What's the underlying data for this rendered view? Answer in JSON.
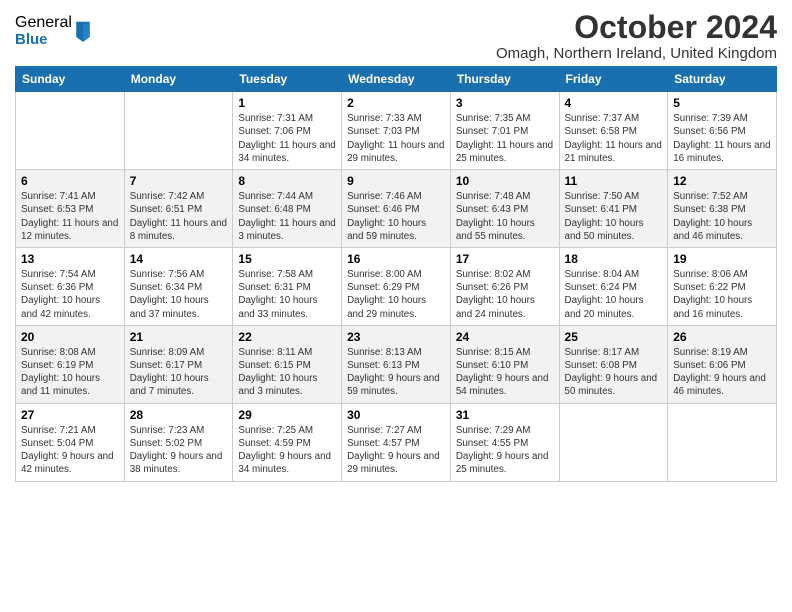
{
  "logo": {
    "general": "General",
    "blue": "Blue"
  },
  "title": "October 2024",
  "subtitle": "Omagh, Northern Ireland, United Kingdom",
  "days_of_week": [
    "Sunday",
    "Monday",
    "Tuesday",
    "Wednesday",
    "Thursday",
    "Friday",
    "Saturday"
  ],
  "weeks": [
    [
      {
        "day": "",
        "detail": ""
      },
      {
        "day": "",
        "detail": ""
      },
      {
        "day": "1",
        "detail": "Sunrise: 7:31 AM\nSunset: 7:06 PM\nDaylight: 11 hours and 34 minutes."
      },
      {
        "day": "2",
        "detail": "Sunrise: 7:33 AM\nSunset: 7:03 PM\nDaylight: 11 hours and 29 minutes."
      },
      {
        "day": "3",
        "detail": "Sunrise: 7:35 AM\nSunset: 7:01 PM\nDaylight: 11 hours and 25 minutes."
      },
      {
        "day": "4",
        "detail": "Sunrise: 7:37 AM\nSunset: 6:58 PM\nDaylight: 11 hours and 21 minutes."
      },
      {
        "day": "5",
        "detail": "Sunrise: 7:39 AM\nSunset: 6:56 PM\nDaylight: 11 hours and 16 minutes."
      }
    ],
    [
      {
        "day": "6",
        "detail": "Sunrise: 7:41 AM\nSunset: 6:53 PM\nDaylight: 11 hours and 12 minutes."
      },
      {
        "day": "7",
        "detail": "Sunrise: 7:42 AM\nSunset: 6:51 PM\nDaylight: 11 hours and 8 minutes."
      },
      {
        "day": "8",
        "detail": "Sunrise: 7:44 AM\nSunset: 6:48 PM\nDaylight: 11 hours and 3 minutes."
      },
      {
        "day": "9",
        "detail": "Sunrise: 7:46 AM\nSunset: 6:46 PM\nDaylight: 10 hours and 59 minutes."
      },
      {
        "day": "10",
        "detail": "Sunrise: 7:48 AM\nSunset: 6:43 PM\nDaylight: 10 hours and 55 minutes."
      },
      {
        "day": "11",
        "detail": "Sunrise: 7:50 AM\nSunset: 6:41 PM\nDaylight: 10 hours and 50 minutes."
      },
      {
        "day": "12",
        "detail": "Sunrise: 7:52 AM\nSunset: 6:38 PM\nDaylight: 10 hours and 46 minutes."
      }
    ],
    [
      {
        "day": "13",
        "detail": "Sunrise: 7:54 AM\nSunset: 6:36 PM\nDaylight: 10 hours and 42 minutes."
      },
      {
        "day": "14",
        "detail": "Sunrise: 7:56 AM\nSunset: 6:34 PM\nDaylight: 10 hours and 37 minutes."
      },
      {
        "day": "15",
        "detail": "Sunrise: 7:58 AM\nSunset: 6:31 PM\nDaylight: 10 hours and 33 minutes."
      },
      {
        "day": "16",
        "detail": "Sunrise: 8:00 AM\nSunset: 6:29 PM\nDaylight: 10 hours and 29 minutes."
      },
      {
        "day": "17",
        "detail": "Sunrise: 8:02 AM\nSunset: 6:26 PM\nDaylight: 10 hours and 24 minutes."
      },
      {
        "day": "18",
        "detail": "Sunrise: 8:04 AM\nSunset: 6:24 PM\nDaylight: 10 hours and 20 minutes."
      },
      {
        "day": "19",
        "detail": "Sunrise: 8:06 AM\nSunset: 6:22 PM\nDaylight: 10 hours and 16 minutes."
      }
    ],
    [
      {
        "day": "20",
        "detail": "Sunrise: 8:08 AM\nSunset: 6:19 PM\nDaylight: 10 hours and 11 minutes."
      },
      {
        "day": "21",
        "detail": "Sunrise: 8:09 AM\nSunset: 6:17 PM\nDaylight: 10 hours and 7 minutes."
      },
      {
        "day": "22",
        "detail": "Sunrise: 8:11 AM\nSunset: 6:15 PM\nDaylight: 10 hours and 3 minutes."
      },
      {
        "day": "23",
        "detail": "Sunrise: 8:13 AM\nSunset: 6:13 PM\nDaylight: 9 hours and 59 minutes."
      },
      {
        "day": "24",
        "detail": "Sunrise: 8:15 AM\nSunset: 6:10 PM\nDaylight: 9 hours and 54 minutes."
      },
      {
        "day": "25",
        "detail": "Sunrise: 8:17 AM\nSunset: 6:08 PM\nDaylight: 9 hours and 50 minutes."
      },
      {
        "day": "26",
        "detail": "Sunrise: 8:19 AM\nSunset: 6:06 PM\nDaylight: 9 hours and 46 minutes."
      }
    ],
    [
      {
        "day": "27",
        "detail": "Sunrise: 7:21 AM\nSunset: 5:04 PM\nDaylight: 9 hours and 42 minutes."
      },
      {
        "day": "28",
        "detail": "Sunrise: 7:23 AM\nSunset: 5:02 PM\nDaylight: 9 hours and 38 minutes."
      },
      {
        "day": "29",
        "detail": "Sunrise: 7:25 AM\nSunset: 4:59 PM\nDaylight: 9 hours and 34 minutes."
      },
      {
        "day": "30",
        "detail": "Sunrise: 7:27 AM\nSunset: 4:57 PM\nDaylight: 9 hours and 29 minutes."
      },
      {
        "day": "31",
        "detail": "Sunrise: 7:29 AM\nSunset: 4:55 PM\nDaylight: 9 hours and 25 minutes."
      },
      {
        "day": "",
        "detail": ""
      },
      {
        "day": "",
        "detail": ""
      }
    ]
  ]
}
